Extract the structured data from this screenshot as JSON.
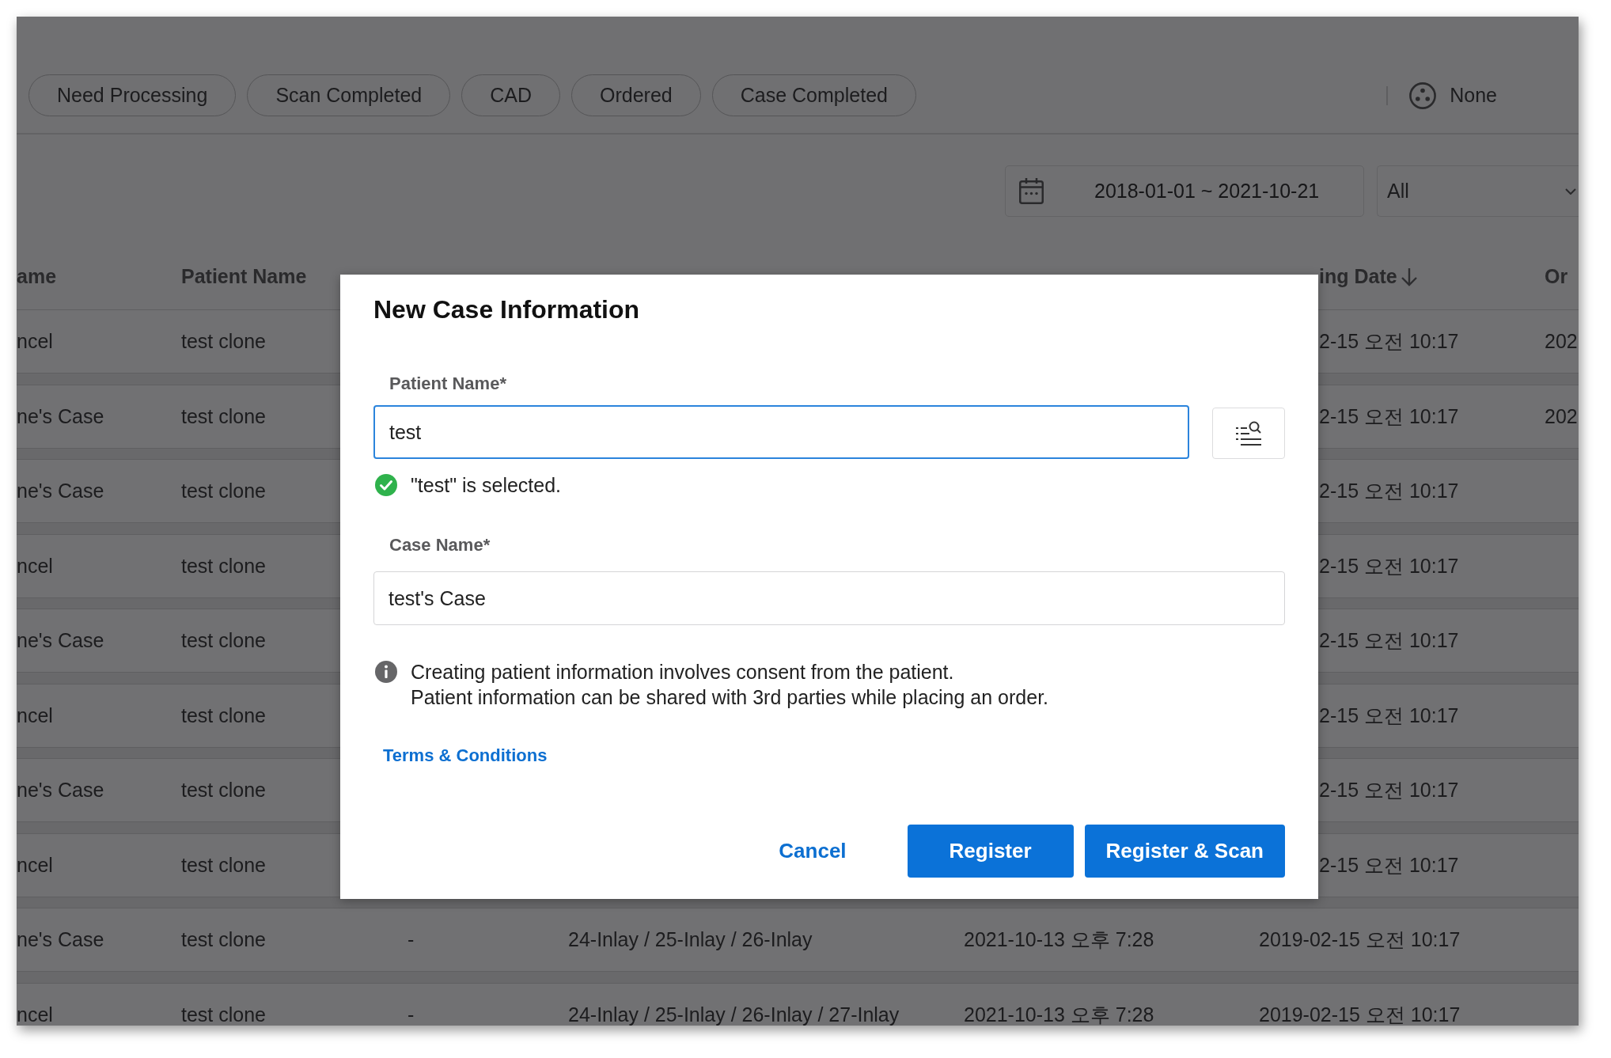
{
  "filter_bar": {
    "chips": [
      "Need Processing",
      "Scan Completed",
      "CAD",
      "Ordered",
      "Case Completed"
    ],
    "selector": {
      "label": "None"
    }
  },
  "toolbar": {
    "date_range": {
      "value": "2018-01-01 ~ 2021-10-21"
    },
    "dropdown": {
      "value": "All"
    }
  },
  "table": {
    "header": {
      "column_1": "ame",
      "patient_name": "Patient Name",
      "column_6": {
        "label": "ing Date",
        "sorted": true
      },
      "column_7": "Or"
    },
    "rows": [
      {
        "column_1": "ncel",
        "patient_name": "test clone",
        "column_6": "2-15 오전 10:17",
        "column_7": "202"
      },
      {
        "column_1": "ne's Case",
        "patient_name": "test clone",
        "column_6": "2-15 오전 10:17",
        "column_7": "202"
      },
      {
        "column_1": "ne's Case",
        "patient_name": "test clone",
        "column_6": "2-15 오전 10:17"
      },
      {
        "column_1": "ncel",
        "patient_name": "test clone",
        "column_6": "2-15 오전 10:17"
      },
      {
        "column_1": "ne's Case",
        "patient_name": "test clone",
        "column_6": "2-15 오전 10:17"
      },
      {
        "column_1": "ncel",
        "patient_name": "test clone",
        "column_6": "2-15 오전 10:17"
      },
      {
        "column_1": "ne's Case",
        "patient_name": "test clone",
        "column_6": "2-15 오전 10:17"
      },
      {
        "column_1": "ncel",
        "patient_name": "test clone",
        "column_6": "2-15 오전 10:17"
      },
      {
        "column_1": "ne's Case",
        "patient_name": "test clone",
        "column_3": "-",
        "column_4": "24-Inlay / 25-Inlay / 26-Inlay",
        "column_5": "2021-10-13 오후 7:28",
        "column_6": "2019-02-15 오전 10:17"
      },
      {
        "column_1": "ncel",
        "patient_name": "test clone",
        "column_3": "-",
        "column_4": "24-Inlay / 25-Inlay / 26-Inlay / 27-Inlay",
        "column_5": "2021-10-13 오후 7:28",
        "column_6": "2019-02-15 오전 10:17"
      }
    ]
  },
  "dialog": {
    "title": "New Case Information",
    "patient_name": {
      "label": "Patient Name*",
      "value": "test",
      "focused": true
    },
    "selection_message": {
      "text": "\"test\" is selected.",
      "valid": true
    },
    "case_name": {
      "label": "Case Name*",
      "value": "test's Case",
      "focused": false
    },
    "notice": [
      "Creating patient information involves consent from the patient.",
      "Patient information can be shared with 3rd parties while placing an order."
    ],
    "terms_link": "Terms & Conditions",
    "actions": [
      {
        "label": "Cancel",
        "kind": "text"
      },
      {
        "label": "Register",
        "kind": "primary"
      },
      {
        "label": "Register & Scan",
        "kind": "primary"
      }
    ]
  }
}
